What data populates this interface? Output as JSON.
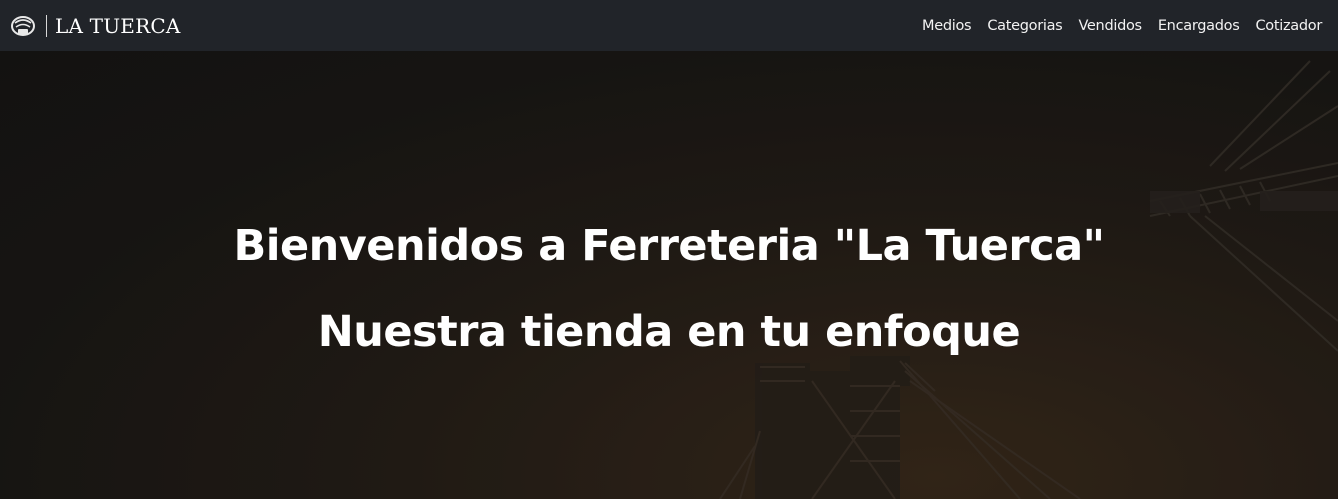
{
  "navbar": {
    "logo_icon": "nut-logo-icon",
    "brand_name": "LA TUERCA",
    "links": [
      {
        "label": "Medios"
      },
      {
        "label": "Categorias"
      },
      {
        "label": "Vendidos"
      },
      {
        "label": "Encargados"
      },
      {
        "label": "Cotizador"
      }
    ],
    "background": "#212429"
  },
  "hero": {
    "title": "Bienvenidos a Ferreteria \"La Tuerca\"",
    "subtitle": "Nuestra tienda en tu enfoque",
    "background_image": "industrial-crane-night-image"
  }
}
